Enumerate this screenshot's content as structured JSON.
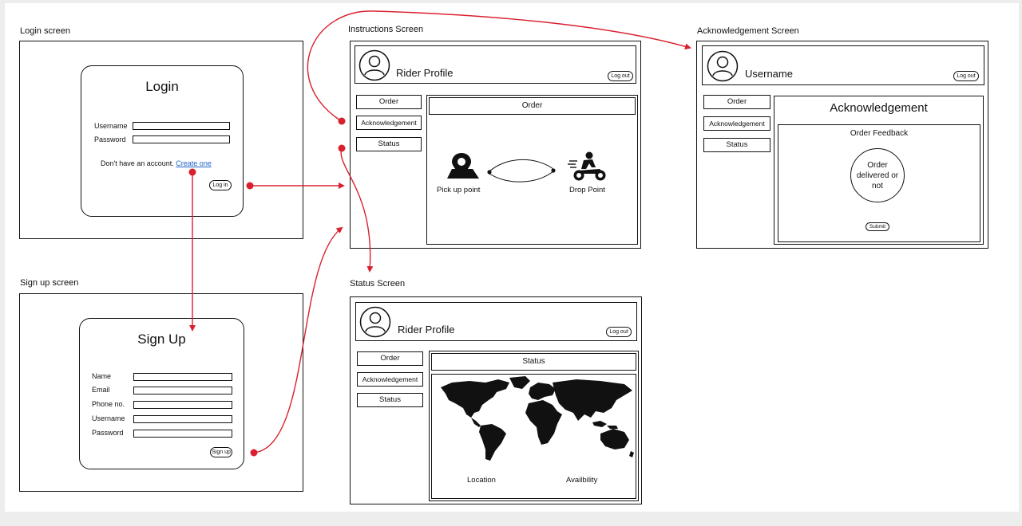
{
  "frames": {
    "login": {
      "title": "Login screen",
      "card_title": "Login",
      "fields": [
        {
          "label": "Username"
        },
        {
          "label": "Password"
        }
      ],
      "account_text": "Don't have an account.",
      "create_link": "Create one",
      "login_button": "Log in"
    },
    "signup": {
      "title": "Sign up screen",
      "card_title": "Sign Up",
      "fields": [
        {
          "label": "Name"
        },
        {
          "label": "Email"
        },
        {
          "label": "Phone no."
        },
        {
          "label": "Username"
        },
        {
          "label": "Password"
        }
      ],
      "signup_button": "Sign up"
    },
    "instructions": {
      "title": "Instructions Screen",
      "header_title": "Rider Profile",
      "logout": "Log out",
      "nav": [
        "Order",
        "Acknowledgement",
        "Status"
      ],
      "content_title": "Order",
      "pickup_label": "Pick up point",
      "drop_label": "Drop Point",
      "pickup_icon": "map-pin-icon",
      "drop_icon": "motorbike-rider-icon"
    },
    "acknowledgement": {
      "title": "Acknowledgement Screen",
      "header_title": "Username",
      "logout": "Log out",
      "nav": [
        "Order",
        "Acknowledgement",
        "Status"
      ],
      "content_title": "Acknowledgement",
      "feedback_title": "Order Feedback",
      "feedback_circle": "Order delivered or not",
      "submit": "Submit"
    },
    "status": {
      "title": "Status Screen",
      "header_title": "Rider Profile",
      "logout": "Log out",
      "nav": [
        "Order",
        "Acknowledgement",
        "Status"
      ],
      "content_title": "Status",
      "map_icon": "world-map-icon",
      "location_label": "Location",
      "availability_label": "Availbility"
    }
  },
  "colors": {
    "connector": "#d9202f",
    "link": "#1e63c7",
    "stroke": "#111111"
  }
}
